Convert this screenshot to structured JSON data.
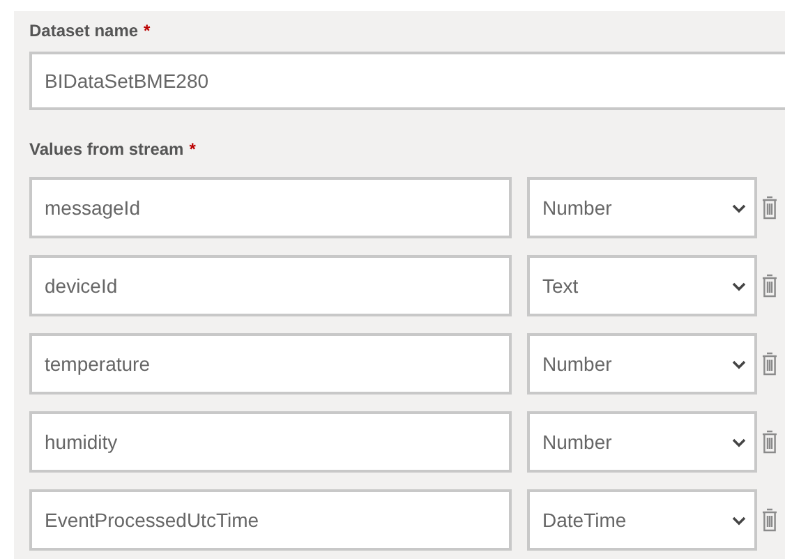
{
  "dataset_name": {
    "label": "Dataset name",
    "required_mark": "*",
    "value": "BIDataSetBME280"
  },
  "values_from_stream": {
    "label": "Values from stream",
    "required_mark": "*",
    "rows": [
      {
        "name": "messageId",
        "type": "Number"
      },
      {
        "name": "deviceId",
        "type": "Text"
      },
      {
        "name": "temperature",
        "type": "Number"
      },
      {
        "name": "humidity",
        "type": "Number"
      },
      {
        "name": "EventProcessedUtcTime",
        "type": "DateTime"
      }
    ]
  }
}
